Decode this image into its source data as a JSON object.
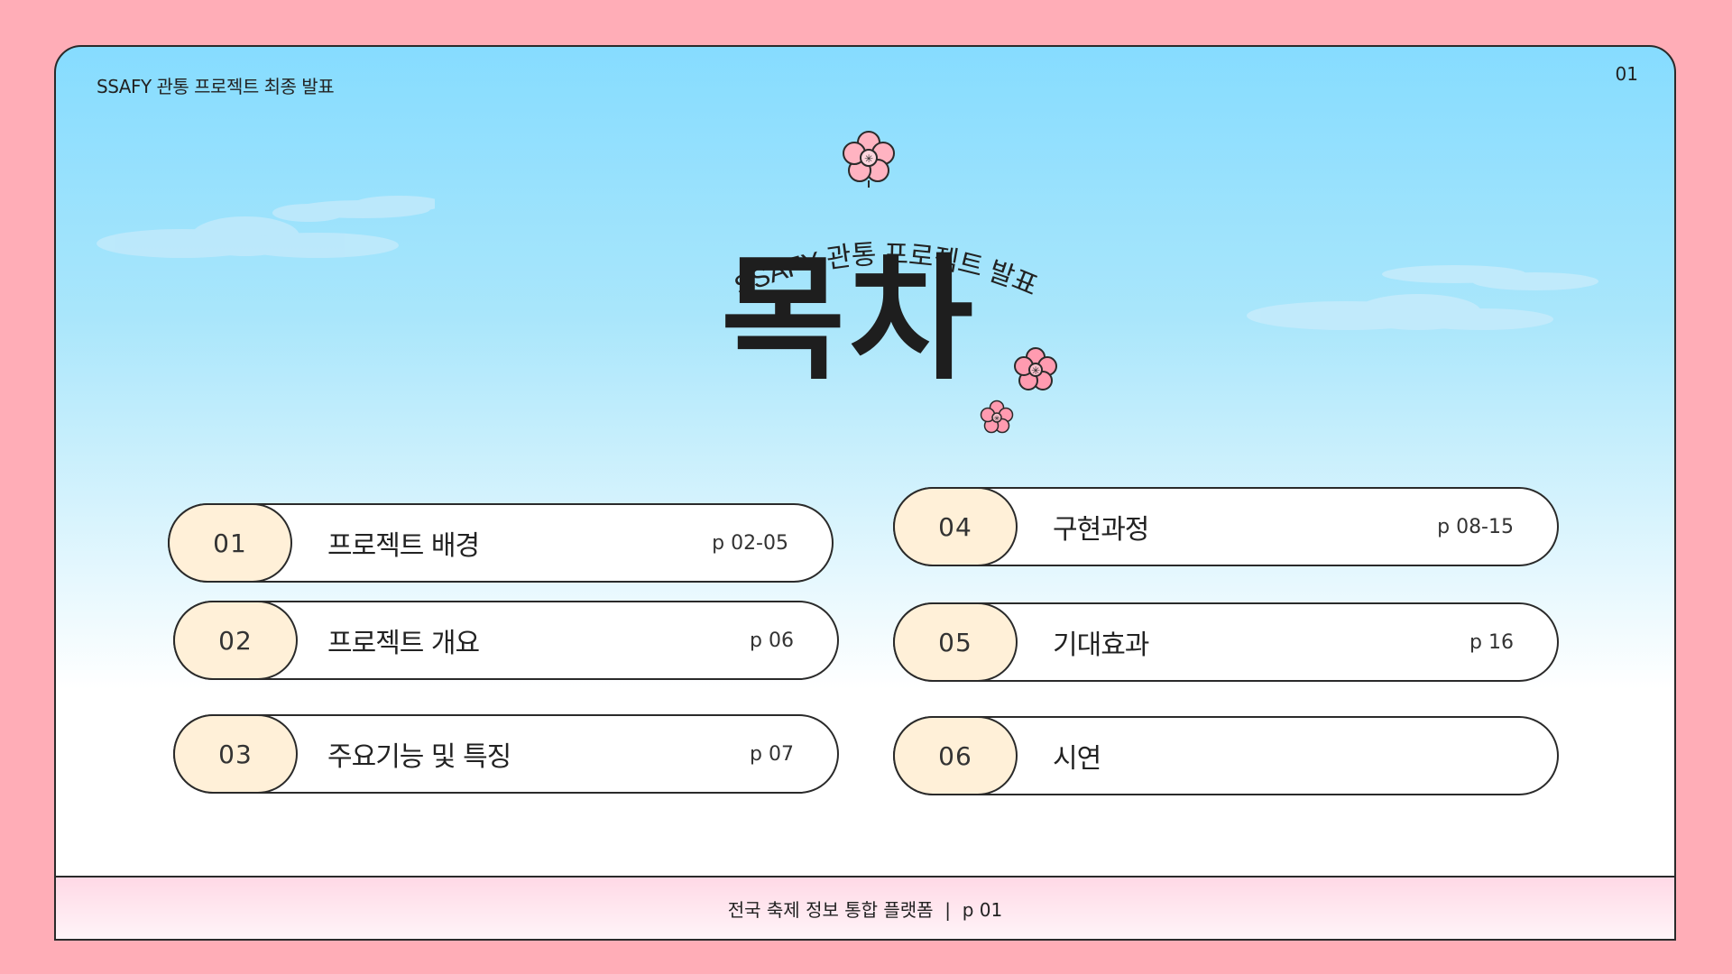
{
  "header": {
    "left_text": "SSAFY 관통 프로젝트 최종 발표",
    "slide_number": "01"
  },
  "title": {
    "subtitle": "SSAFY 관통 프로젝트 발표",
    "main": "목차"
  },
  "toc": [
    {
      "num": "01",
      "label": "프로젝트 배경",
      "page": "p 02-05"
    },
    {
      "num": "02",
      "label": "프로젝트 개요",
      "page": "p 06"
    },
    {
      "num": "03",
      "label": "주요기능 및 특징",
      "page": "p 07"
    },
    {
      "num": "04",
      "label": "구현과정",
      "page": "p 08-15"
    },
    {
      "num": "05",
      "label": "기대효과",
      "page": "p 16"
    },
    {
      "num": "06",
      "label": "시연",
      "page": ""
    }
  ],
  "footer": {
    "text": "전국 축제 정보 통합 플랫폼  |  p 01"
  },
  "colors": {
    "background": "#ffadb7",
    "sky_top": "#86dcff",
    "number_fill": "#fff0d8",
    "flower": "#ffb3c1",
    "footer_bg": "#ffd9e6"
  }
}
